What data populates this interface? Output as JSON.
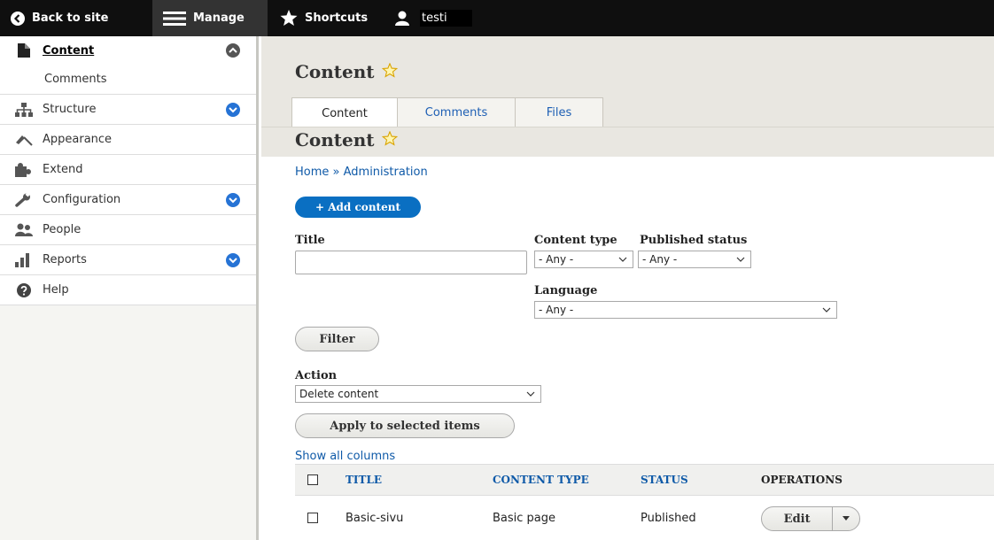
{
  "toolbar": {
    "back": "Back to site",
    "manage": "Manage",
    "shortcuts": "Shortcuts",
    "user": "testi"
  },
  "sidebar": {
    "items": [
      {
        "label": "Content",
        "icon": "file-icon",
        "toggle": "up"
      },
      {
        "label": "Comments"
      },
      {
        "label": "Structure",
        "icon": "sitemap-icon",
        "toggle": "down"
      },
      {
        "label": "Appearance",
        "icon": "brush-icon"
      },
      {
        "label": "Extend",
        "icon": "puzzle-icon"
      },
      {
        "label": "Configuration",
        "icon": "wrench-icon",
        "toggle": "down"
      },
      {
        "label": "People",
        "icon": "people-icon"
      },
      {
        "label": "Reports",
        "icon": "bar-chart-icon",
        "toggle": "down"
      },
      {
        "label": "Help",
        "icon": "help-icon"
      }
    ]
  },
  "page": {
    "title": "Content",
    "tabs": [
      {
        "label": "Content",
        "active": true
      },
      {
        "label": "Comments"
      },
      {
        "label": "Files"
      }
    ],
    "subtitle": "Content",
    "breadcrumb": "Home » Administration",
    "add_button": "+ Add content"
  },
  "filters": {
    "title_label": "Title",
    "title_value": "",
    "content_type_label": "Content type",
    "content_type_value": "- Any -",
    "published_label": "Published status",
    "published_value": "- Any -",
    "language_label": "Language",
    "language_value": "- Any -",
    "filter_button": "Filter"
  },
  "bulk": {
    "action_label": "Action",
    "action_value": "Delete content",
    "apply_button": "Apply to selected items",
    "show_columns": "Show all columns"
  },
  "table": {
    "headers": [
      "TITLE",
      "CONTENT TYPE",
      "STATUS",
      "OPERATIONS"
    ],
    "rows": [
      {
        "title": "Basic-sivu",
        "type": "Basic page",
        "status": "Published",
        "operation": "Edit"
      }
    ]
  },
  "colors": {
    "toolbar": "#0f0f0f",
    "accent": "#0a6fc2",
    "link": "#0f5aa8",
    "header_bg": "#e9e7e1"
  }
}
